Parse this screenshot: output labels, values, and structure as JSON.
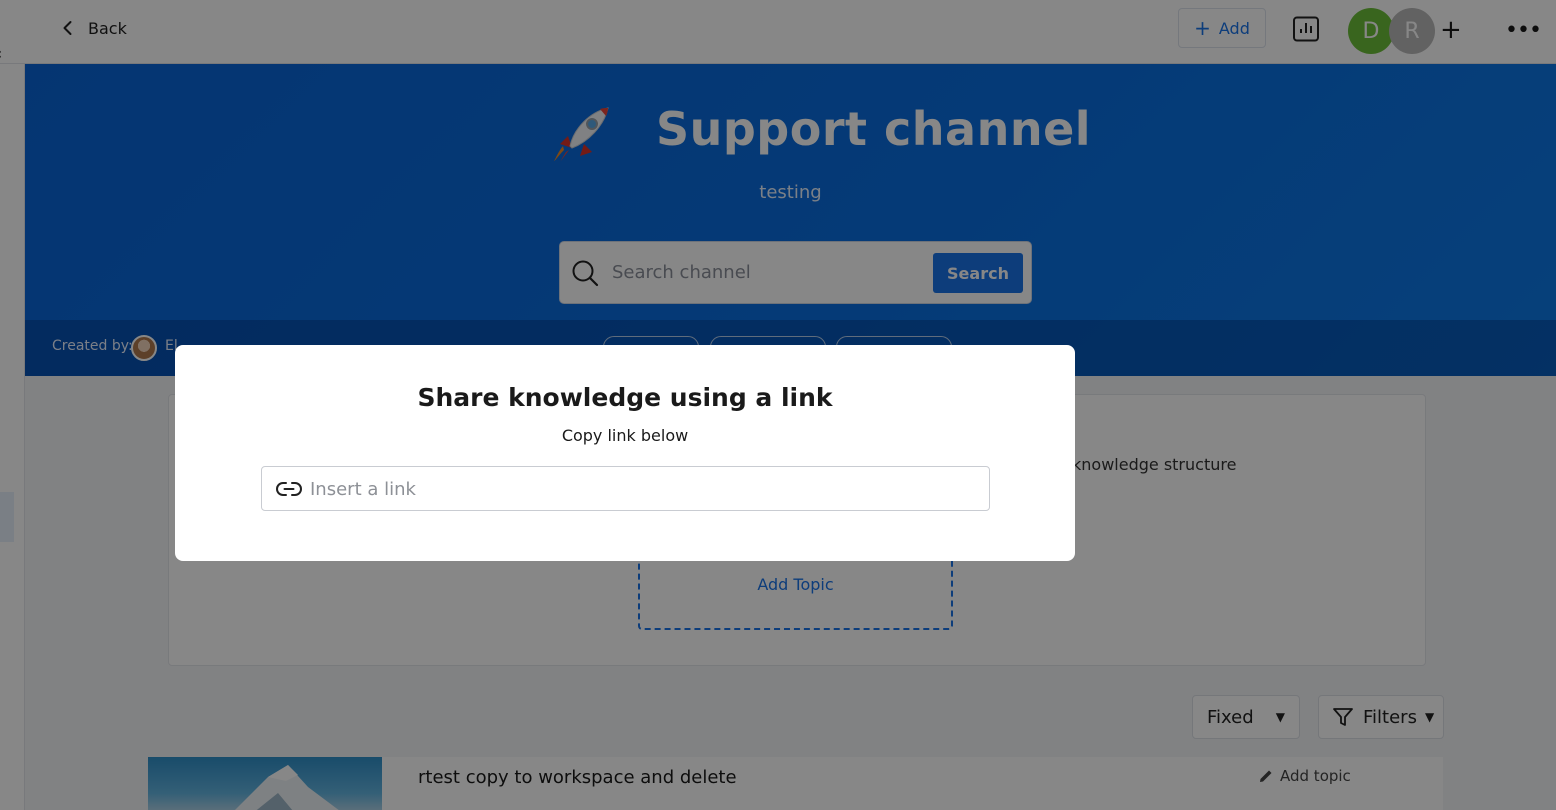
{
  "topbar": {
    "back_label": "Back",
    "add_label": "Add",
    "avatars": [
      "D",
      "R"
    ],
    "add_member_symbol": "+",
    "more_symbol": "•••"
  },
  "hero": {
    "title": "Support channel",
    "subtitle": "testing",
    "search_placeholder": "Search channel",
    "search_button": "Search",
    "created_by_label": "Created by:",
    "creator_text": "El"
  },
  "content": {
    "structure_text": "knowledge structure",
    "add_topic_label": "Add Topic",
    "sort_value": "Fixed",
    "filters_label": "Filters"
  },
  "post": {
    "title": "rtest copy to workspace and delete",
    "add_topic_label": "Add topic"
  },
  "modal": {
    "title": "Share knowledge using a link",
    "subtitle": "Copy link below",
    "input_placeholder": "Insert a link",
    "input_value": ""
  },
  "colors": {
    "accent": "#1a73e8",
    "hero_blue": "#0a6ee0",
    "avatar_d": "#6cbf3a",
    "avatar_r": "#b9b9b9"
  },
  "icons": [
    "chevron-left-icon",
    "plus-icon",
    "analytics-icon",
    "more-icon",
    "rocket-icon",
    "search-icon",
    "filter-icon",
    "pencil-icon",
    "link-icon"
  ]
}
